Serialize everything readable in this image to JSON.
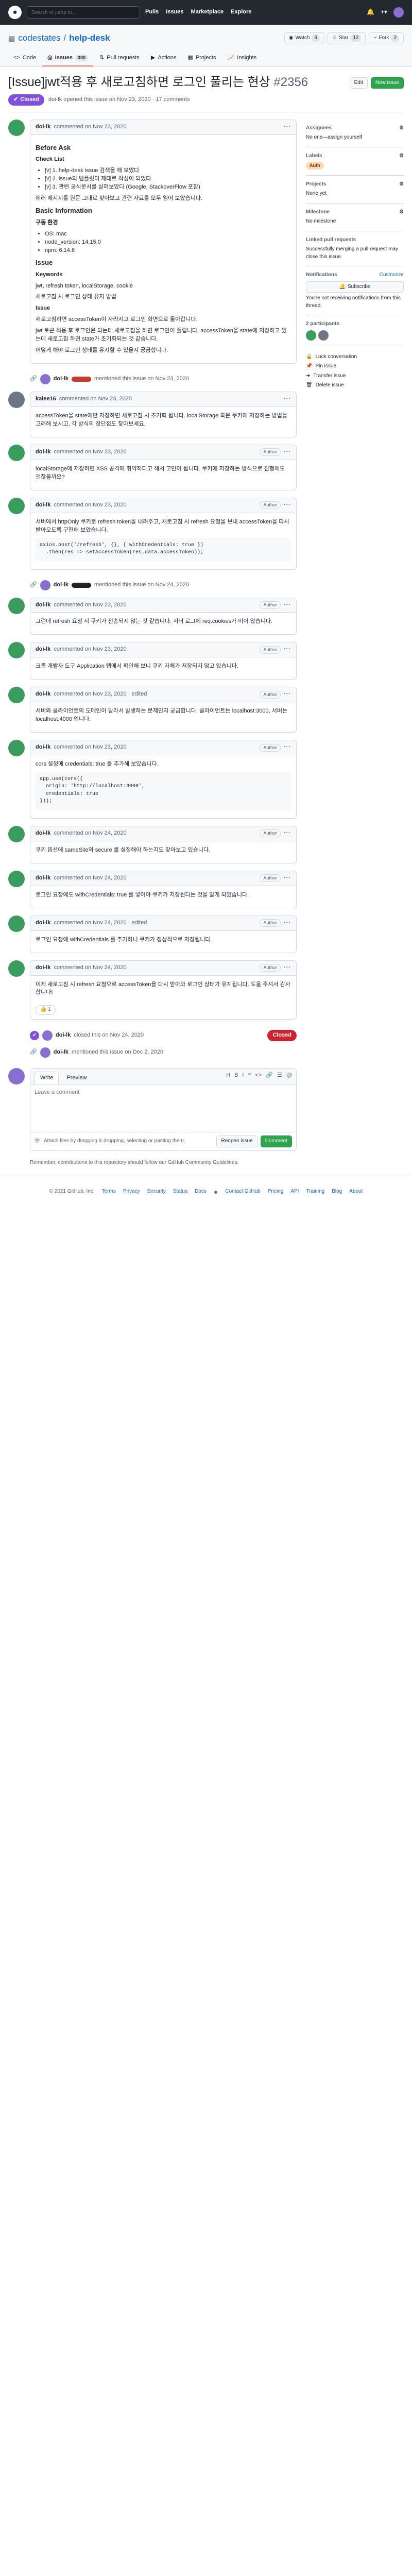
{
  "header": {
    "search_placeholder": "Search or jump to...",
    "nav": [
      "Pulls",
      "Issues",
      "Marketplace",
      "Explore"
    ]
  },
  "repo": {
    "owner": "codestates",
    "name": "help-desk",
    "watch_label": "Watch",
    "watch_count": "9",
    "fork_label": "Fork",
    "fork_count": "2",
    "star_label": "Star",
    "star_count": "12",
    "tabs": [
      {
        "label": "Code",
        "count": ""
      },
      {
        "label": "Issues",
        "count": "300"
      },
      {
        "label": "Pull requests",
        "count": ""
      },
      {
        "label": "Actions",
        "count": ""
      },
      {
        "label": "Projects",
        "count": ""
      },
      {
        "label": "Insights",
        "count": ""
      }
    ]
  },
  "issue": {
    "title": "[Issue]jwt적용 후 새로고침하면 로그인 풀리는 현상",
    "number": "#2356",
    "edit_label": "Edit",
    "new_issue_label": "New issue",
    "state": "Closed",
    "meta": "doi-lk opened this issue on Nov 23, 2020 · 17 comments"
  },
  "comments": [
    {
      "author": "doi-lk",
      "time": "commented on Nov 23, 2020",
      "role": "",
      "heading1": "Before Ask",
      "sub1": "Check List",
      "check": [
        "[v] 1. help-desk issue 검색을 해 보았다",
        "[v] 2. issue의 템플릿이 제대로 작성이 되었다",
        "[v] 3. 관련 공식문서를 살펴보았다 (Google, StackoverFlow 포함)"
      ],
      "desc": "에러 메시지를 원문 그대로 찾아보고 관련 자료를 모두 읽어 보았습니다.",
      "heading2": "Basic Information",
      "sub2": "구동 환경",
      "env": [
        "OS: mac",
        "node_version: 14.15.0",
        "npm: 6.14.8"
      ],
      "heading3": "Issue",
      "sub3": "Keywords",
      "kw": "jwt, refresh token, localStorage, cookie",
      "kw2": "새로고침 시 로그인 상태 유지 방법",
      "body1": "jwt 토큰 적용 후 로그인은 되는데 새로고침을 하면 로그인이 풀립니다. accessToken을 state에 저장하고 있는데 새로고침 하면 state가 초기화되는 것 같습니다.",
      "body2": "어떻게 해야 로그인 상태를 유지할 수 있을지 궁금합니다.",
      "issue_label": "Issue",
      "issue_text": "새로고침하면 accessToken이 사라지고 로그인 화면으로 돌아갑니다."
    },
    {
      "author": "kalee16",
      "time": "commented on Nov 23, 2020",
      "role": "",
      "text": "accessToken을 state에만 저장하면 새로고침 시 초기화 됩니다. localStorage 혹은 쿠키에 저장하는 방법을 고려해 보시고, 각 방식의 장단점도 찾아보세요."
    },
    {
      "author": "doi-lk",
      "time": "commented on Nov 23, 2020",
      "role": "Author",
      "text": "localStorage에 저장하면 XSS 공격에 취약하다고 해서 고민이 됩니다. 쿠키에 저장하는 방식으로 진행해도 괜찮을까요?"
    },
    {
      "author": "doi-lk",
      "time": "commented on Nov 23, 2020",
      "role": "Author",
      "text": "서버에서 httpOnly 쿠키로 refresh token을 내려주고, 새로고침 시 refresh 요청을 보내 accessToken을 다시 받아오도록 구현해 보았습니다.",
      "code": "axios.post('/refresh', {}, { withCredentials: true })\n  .then(res => setAccessToken(res.data.accessToken));"
    },
    {
      "author": "doi-lk",
      "time": "commented on Nov 23, 2020",
      "role": "Author",
      "text": "그런데 refresh 요청 시 쿠키가 전송되지 않는 것 같습니다. 서버 로그에 req.cookies가 비어 있습니다."
    },
    {
      "author": "doi-lk",
      "time": "commented on Nov 23, 2020",
      "role": "Author",
      "text": "크롬 개발자 도구 Application 탭에서 확인해 보니 쿠키 자체가 저장되지 않고 있습니다."
    },
    {
      "author": "doi-lk",
      "time": "commented on Nov 23, 2020 · edited",
      "role": "Author",
      "text": "서버와 클라이언트의 도메인이 달라서 발생하는 문제인지 궁금합니다. 클라이언트는 localhost:3000, 서버는 localhost:4000 입니다."
    },
    {
      "author": "doi-lk",
      "time": "commented on Nov 23, 2020",
      "role": "Author",
      "text": "cors 설정에 credentials: true 를 추가해 보았습니다.",
      "code": "app.use(cors({\n  origin: 'http://localhost:3000',\n  credentials: true\n}));"
    },
    {
      "author": "doi-lk",
      "time": "commented on Nov 24, 2020",
      "role": "Author",
      "text": "쿠키 옵션에 sameSite와 secure 를 설정해야 하는지도 찾아보고 있습니다."
    },
    {
      "author": "doi-lk",
      "time": "commented on Nov 24, 2020",
      "role": "Author",
      "text": "로그인 요청에도 withCredentials: true 를 넣어야 쿠키가 저장된다는 것을 알게 되었습니다."
    },
    {
      "author": "doi-lk",
      "time": "commented on Nov 24, 2020 · edited",
      "role": "Author",
      "text": "로그인 요청에 withCredentials 를 추가하니 쿠키가 정상적으로 저장됩니다."
    },
    {
      "author": "doi-lk",
      "time": "commented on Nov 24, 2020",
      "role": "Author",
      "text": "이제 새로고침 시 refresh 요청으로 accessToken을 다시 받아와 로그인 상태가 유지됩니다. 도움 주셔서 감사합니다!"
    }
  ],
  "mentions": [
    {
      "author": "doi-lk",
      "text": "mentioned this issue on Nov 23, 2020"
    },
    {
      "author": "doi-lk",
      "text": "mentioned this issue on Nov 24, 2020"
    }
  ],
  "close_events": [
    {
      "author": "doi-lk",
      "text": "closed this on Nov 24, 2020",
      "badge": "Closed"
    },
    {
      "author": "doi-lk",
      "text": "mentioned this issue on Dec 2, 2020"
    }
  ],
  "reactions": {
    "thumbs": "👍 1"
  },
  "sidebar": {
    "assignees_title": "Assignees",
    "assignees_text": "No one—assign yourself",
    "labels_title": "Labels",
    "label": "Auth",
    "projects_title": "Projects",
    "projects_text": "None yet",
    "milestone_title": "Milestone",
    "milestone_text": "No milestone",
    "linked_title": "Linked pull requests",
    "linked_text": "Successfully merging a pull request may close this issue.",
    "notif_title": "Notifications",
    "customize": "Customize",
    "subscribe_label": "Subscribe",
    "notif_text": "You're not receiving notifications from this thread.",
    "participants_title": "2 participants",
    "lock_label": "Lock conversation",
    "pin_label": "Pin issue",
    "transfer_label": "Transfer issue",
    "delete_label": "Delete issue"
  },
  "editor": {
    "write_tab": "Write",
    "preview_tab": "Preview",
    "placeholder": "Leave a comment",
    "attach_text": "Attach files by dragging & dropping, selecting or pasting them.",
    "reopen_label": "Reopen issue",
    "comment_label": "Comment",
    "tip": "Remember, contributions to this repository should follow our GitHub Community Guidelines."
  },
  "footer": {
    "copyright": "© 2021 GitHub, Inc.",
    "links": [
      "Terms",
      "Privacy",
      "Security",
      "Status",
      "Docs",
      "Contact GitHub",
      "Pricing",
      "API",
      "Training",
      "Blog",
      "About"
    ]
  },
  "colors": {
    "accent": "#0969da",
    "closed": "#8250df",
    "header": "#24292f",
    "label": "#ffd8b5"
  }
}
